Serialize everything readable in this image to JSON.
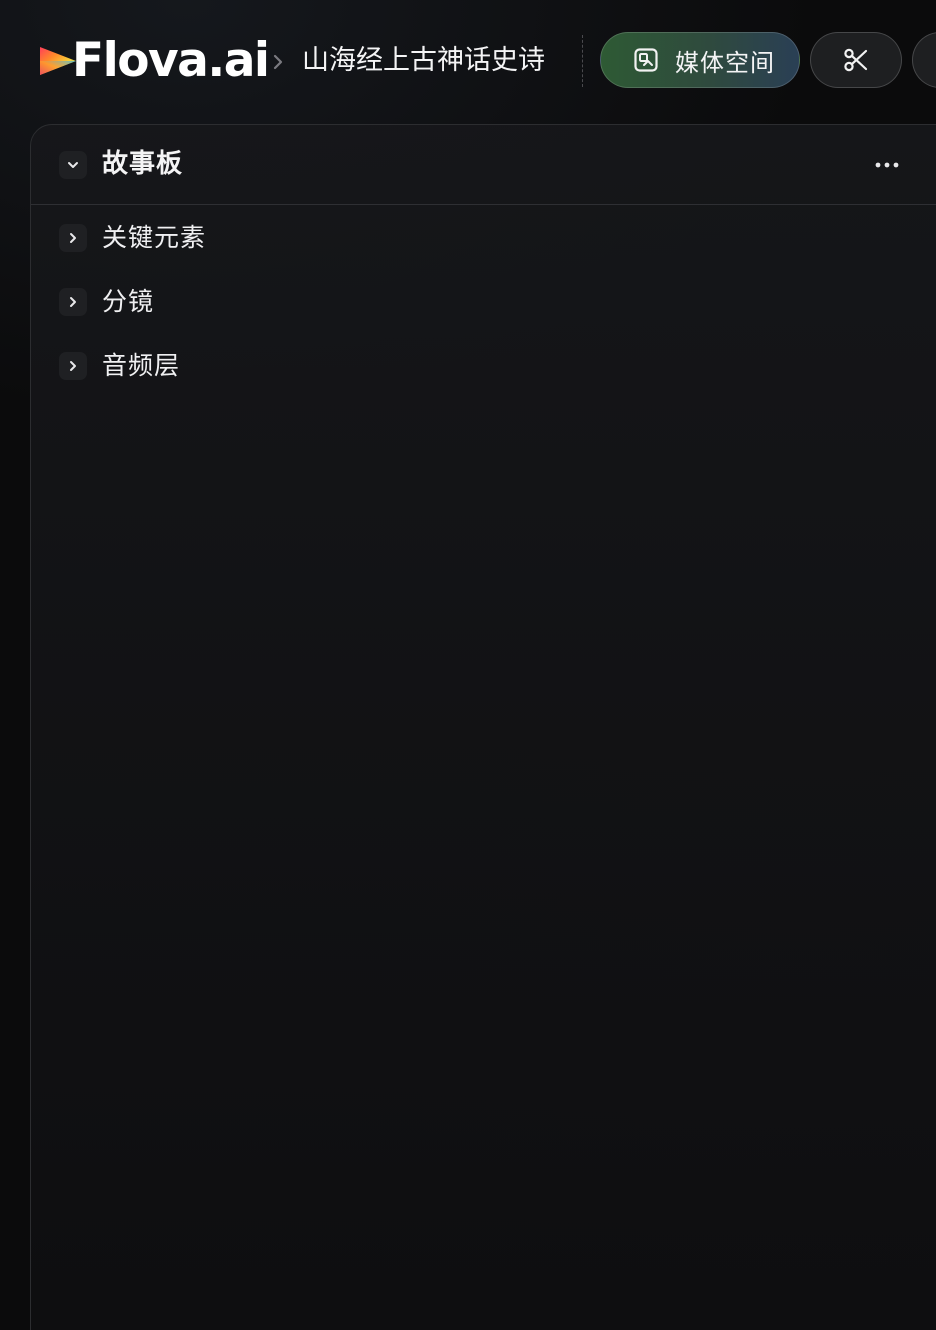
{
  "app": {
    "brand": "Flova.ai",
    "project_title": "山海经上古神话史诗"
  },
  "toolbar": {
    "media_space_label": "媒体空间",
    "media_space_icon": "image-frame-icon",
    "cut_icon": "scissors-icon"
  },
  "panel": {
    "title": "故事板",
    "more_icon": "more-horizontal-icon",
    "items": [
      {
        "label": "关键元素"
      },
      {
        "label": "分镜"
      },
      {
        "label": "音频层"
      }
    ]
  },
  "colors": {
    "background": "#0b0b0c",
    "media_button_green": "#2e5a34",
    "media_button_blue": "#2a3f55",
    "panel_border": "#2c2d30",
    "text": "#f4f4f5"
  }
}
